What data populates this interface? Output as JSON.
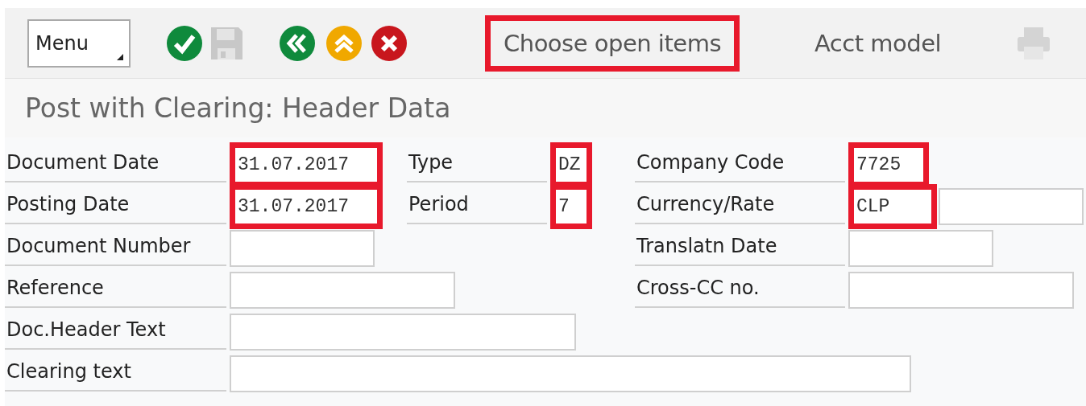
{
  "toolbar": {
    "menu": "Menu",
    "icons": [
      {
        "kind": "check",
        "disabled": false
      },
      {
        "kind": "save",
        "disabled": true
      },
      {
        "kind": "back",
        "disabled": false
      },
      {
        "kind": "exit",
        "disabled": false
      },
      {
        "kind": "cancel",
        "disabled": false
      }
    ],
    "buttons": [
      {
        "label": "Choose open items",
        "highlighted": true
      },
      {
        "label": "Acct model",
        "highlighted": false
      }
    ],
    "print": {
      "disabled": true
    }
  },
  "title": "Post with Clearing: Header Data",
  "rows": [
    {
      "groups": [
        {
          "label": "Document Date",
          "fields": [
            {
              "value": "31.07.2017",
              "highlighted": true
            }
          ]
        },
        {
          "label": "Type",
          "fields": [
            {
              "value": "DZ",
              "highlighted": true
            }
          ]
        },
        {
          "label": "Company Code",
          "fields": [
            {
              "value": "7725",
              "highlighted": true
            }
          ]
        }
      ]
    },
    {
      "groups": [
        {
          "label": "Posting Date",
          "fields": [
            {
              "value": "31.07.2017",
              "highlighted": true
            }
          ]
        },
        {
          "label": "Period",
          "fields": [
            {
              "value": "7",
              "highlighted": true
            }
          ]
        },
        {
          "label": "Currency/Rate",
          "fields": [
            {
              "value": "CLP",
              "highlighted": true
            },
            {
              "highlighted": false
            }
          ]
        }
      ]
    },
    {
      "groups": [
        {
          "label": "Document Number",
          "fields": [
            {
              "highlighted": false
            }
          ]
        },
        {
          "label": "Translatn Date",
          "fields": [
            {
              "highlighted": false
            }
          ]
        }
      ]
    },
    {
      "groups": [
        {
          "label": "Reference",
          "fields": [
            {
              "highlighted": false
            }
          ]
        },
        {
          "label": "Cross-CC no.",
          "fields": [
            {
              "highlighted": false
            }
          ]
        }
      ]
    },
    {
      "groups": [
        {
          "label": "Doc.Header Text",
          "fields": [
            {
              "highlighted": false
            }
          ]
        }
      ]
    },
    {
      "groups": [
        {
          "label": "Clearing text",
          "fields": [
            {
              "highlighted": false
            }
          ]
        }
      ]
    }
  ]
}
